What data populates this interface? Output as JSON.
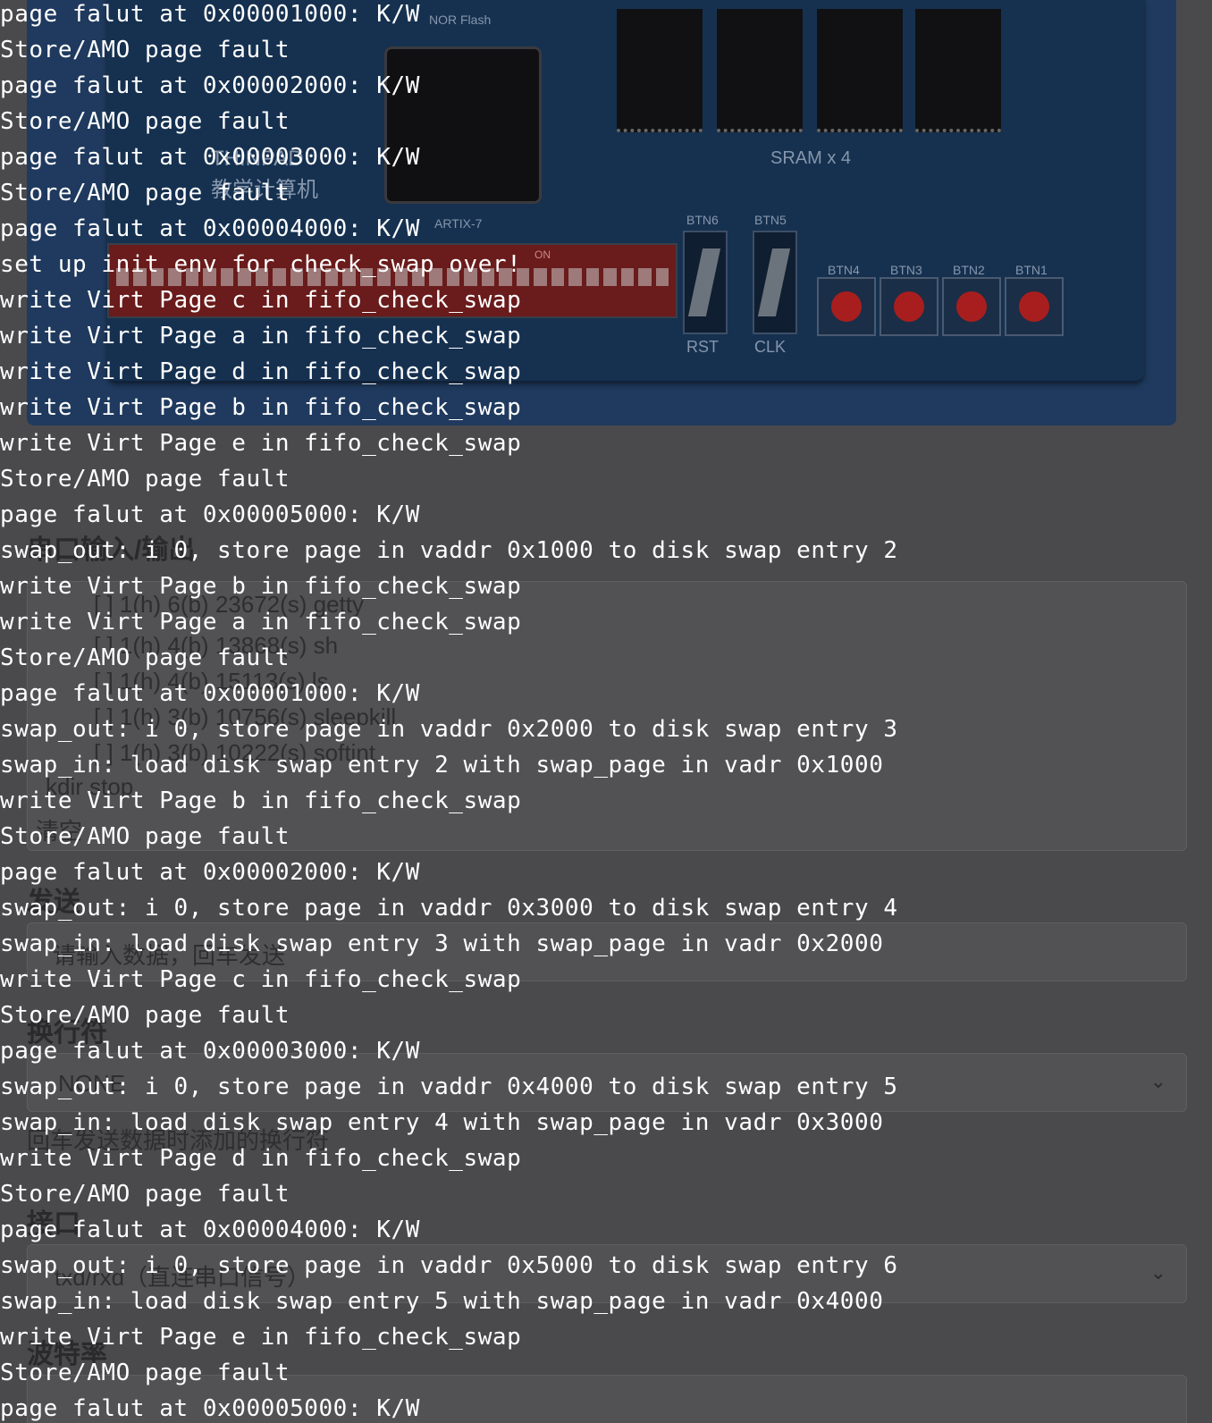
{
  "board": {
    "nor_flash_label": "NOR Flash",
    "thinpad_label": "THINPAD",
    "thinpad_sub_label": "教学计算机",
    "artix_label": "ARTIX-7",
    "sram_label": "SRAM x 4",
    "dip_on_label": "ON",
    "btn6_label": "BTN6",
    "btn5_label": "BTN5",
    "rst_label": "RST",
    "clk_label": "CLK",
    "btn4_label": "BTN4",
    "btn3_label": "BTN3",
    "btn2_label": "BTN2",
    "btn1_label": "BTN1"
  },
  "serial_panel": {
    "heading": "串口输入/输出",
    "process_lines": [
      "[ ] 1(h)    6(b)   23672(s)   getty",
      "[ ] 1(h)    4(b)   13868(s)   sh",
      "[ ] 1(h)    4(b)   15113(s)   ls",
      "[ ] 1(h)    3(b)   10756(s)   sleepkill",
      "[ ] 1(h)    3(b)   10222(s)   softint",
      "kdir stop"
    ],
    "clear_label": "清空",
    "send_heading": "发送",
    "send_placeholder": "请输入数据，回车发送",
    "newline_heading": "换行符",
    "newline_value": "NONE",
    "newline_hint": "回车发送数据时添加的换行符",
    "port_heading": "接口",
    "port_value": "txd/rxd（直连串口信号）",
    "baud_heading": "波特率"
  },
  "console": {
    "lines": [
      "page falut at 0x00001000: K/W",
      "Store/AMO page fault",
      "page falut at 0x00002000: K/W",
      "Store/AMO page fault",
      "page falut at 0x00003000: K/W",
      "Store/AMO page fault",
      "page falut at 0x00004000: K/W",
      "set up init env for check_swap over!",
      "write Virt Page c in fifo_check_swap",
      "write Virt Page a in fifo_check_swap",
      "write Virt Page d in fifo_check_swap",
      "write Virt Page b in fifo_check_swap",
      "write Virt Page e in fifo_check_swap",
      "Store/AMO page fault",
      "page falut at 0x00005000: K/W",
      "swap_out: i 0, store page in vaddr 0x1000 to disk swap entry 2",
      "write Virt Page b in fifo_check_swap",
      "write Virt Page a in fifo_check_swap",
      "Store/AMO page fault",
      "page falut at 0x00001000: K/W",
      "swap_out: i 0, store page in vaddr 0x2000 to disk swap entry 3",
      "swap_in: load disk swap entry 2 with swap_page in vadr 0x1000",
      "write Virt Page b in fifo_check_swap",
      "Store/AMO page fault",
      "page falut at 0x00002000: K/W",
      "swap_out: i 0, store page in vaddr 0x3000 to disk swap entry 4",
      "swap_in: load disk swap entry 3 with swap_page in vadr 0x2000",
      "write Virt Page c in fifo_check_swap",
      "Store/AMO page fault",
      "page falut at 0x00003000: K/W",
      "swap_out: i 0, store page in vaddr 0x4000 to disk swap entry 5",
      "swap_in: load disk swap entry 4 with swap_page in vadr 0x3000",
      "write Virt Page d in fifo_check_swap",
      "Store/AMO page fault",
      "page falut at 0x00004000: K/W",
      "swap_out: i 0, store page in vaddr 0x5000 to disk swap entry 6",
      "swap_in: load disk swap entry 5 with swap_page in vadr 0x4000",
      "write Virt Page e in fifo_check_swap",
      "Store/AMO page fault",
      "page falut at 0x00005000: K/W"
    ]
  }
}
